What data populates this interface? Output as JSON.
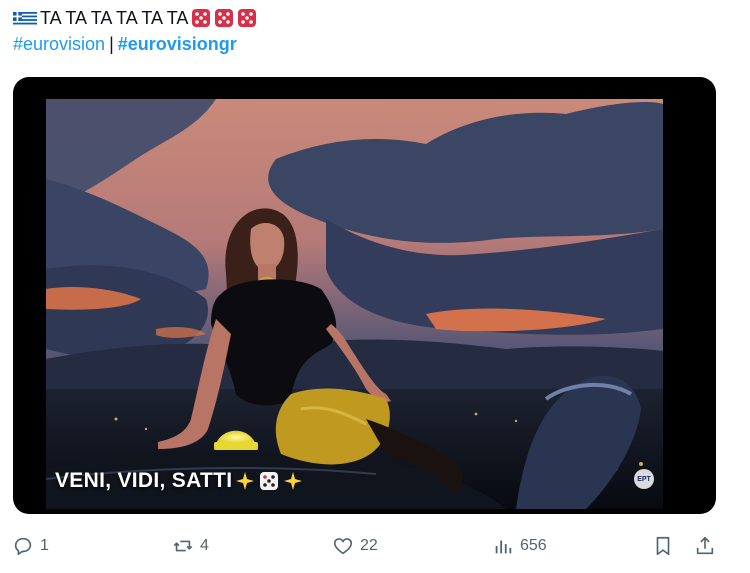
{
  "post": {
    "text_main": "TA TA TA TA TA TA",
    "hashtag1": "#eurovision",
    "separator": "|",
    "hashtag2": "#eurovisiongr",
    "emoji_prefix": "greece-flag",
    "emoji_suffix": [
      "game-die",
      "game-die",
      "game-die"
    ]
  },
  "media": {
    "caption": "VENI, VIDI, SATTI",
    "caption_emojis": [
      "sparkles",
      "game-die",
      "sparkles"
    ],
    "channel_logo": "ΕΡΤ"
  },
  "actions": {
    "reply_count": "1",
    "repost_count": "4",
    "like_count": "22",
    "views_count": "656"
  },
  "colors": {
    "link": "#1d9bf0",
    "icon": "#536471",
    "text": "#0f1419"
  }
}
